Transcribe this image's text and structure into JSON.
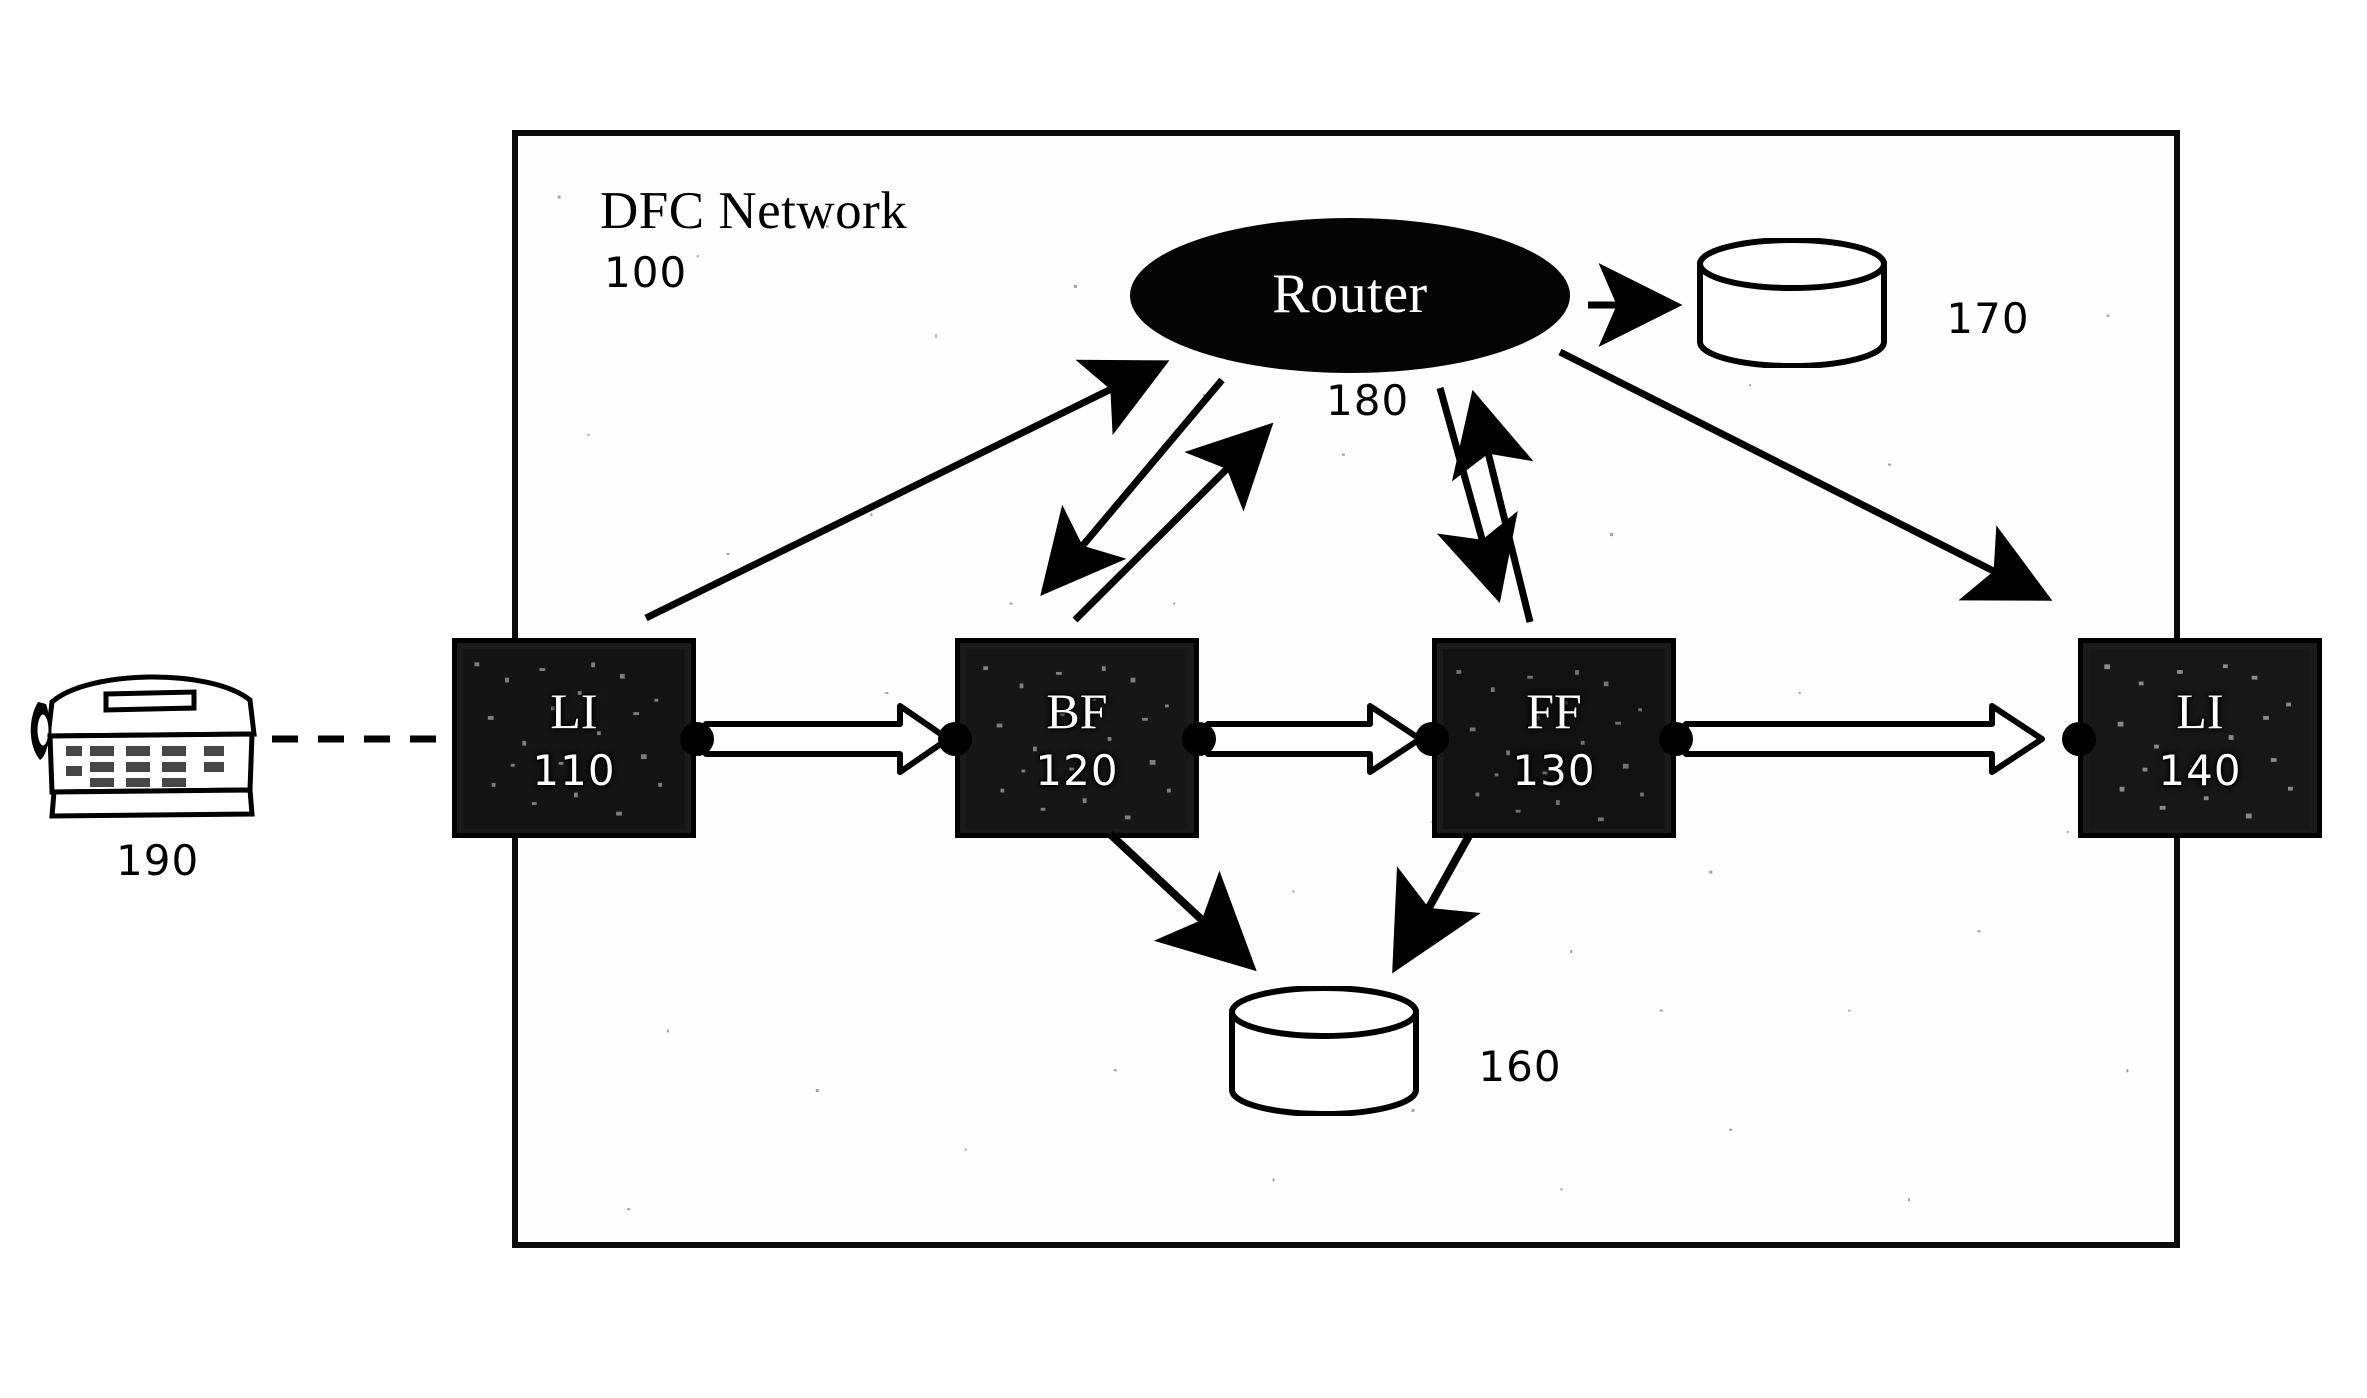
{
  "figure": {
    "title": "DFC Network",
    "reference_numeral": "100",
    "type": "network block diagram"
  },
  "frame": {
    "label": "DFC Network",
    "ref": "100"
  },
  "router": {
    "label": "Router",
    "ref": "180",
    "shape": "ellipse",
    "fill": "#050505",
    "text_color": "#ffffff"
  },
  "nodes": [
    {
      "id": "li-110",
      "code": "LI",
      "ref": "110",
      "name": "line-interface-110"
    },
    {
      "id": "bf-120",
      "code": "BF",
      "ref": "120",
      "name": "basic-feature-120"
    },
    {
      "id": "ff-130",
      "code": "FF",
      "ref": "130",
      "name": "free-feature-130"
    },
    {
      "id": "li-140",
      "code": "LI",
      "ref": "140",
      "name": "line-interface-140"
    }
  ],
  "data_stores": [
    {
      "id": "store-170",
      "ref": "170",
      "shape": "cylinder"
    },
    {
      "id": "store-160",
      "ref": "160",
      "shape": "cylinder"
    }
  ],
  "endpoint": {
    "ref": "190",
    "icon": "telephone-icon",
    "link_style": "dashed"
  },
  "connections": [
    {
      "from": "li-110",
      "to": "bf-120",
      "style": "hollow-block-arrow"
    },
    {
      "from": "bf-120",
      "to": "ff-130",
      "style": "hollow-block-arrow"
    },
    {
      "from": "ff-130",
      "to": "li-140",
      "style": "hollow-block-arrow"
    },
    {
      "from": "phone-190",
      "to": "li-110",
      "style": "dashed-line"
    },
    {
      "from": "li-110",
      "to": "router",
      "style": "solid-arrow"
    },
    {
      "from": "bf-120",
      "to": "router",
      "style": "solid-arrow"
    },
    {
      "from": "router",
      "to": "bf-120",
      "style": "solid-arrow"
    },
    {
      "from": "ff-130",
      "to": "router",
      "style": "solid-arrow"
    },
    {
      "from": "router",
      "to": "ff-130",
      "style": "solid-arrow"
    },
    {
      "from": "router",
      "to": "store-170",
      "style": "solid-arrow"
    },
    {
      "from": "router",
      "to": "li-140",
      "style": "solid-arrow"
    },
    {
      "from": "bf-120",
      "to": "store-160",
      "style": "solid-arrow"
    },
    {
      "from": "ff-130",
      "to": "store-160",
      "style": "solid-arrow"
    }
  ],
  "colors": {
    "ink": "#000000",
    "paper": "#ffffff",
    "node_fill": "#1a1a1a",
    "router_fill": "#050505"
  }
}
